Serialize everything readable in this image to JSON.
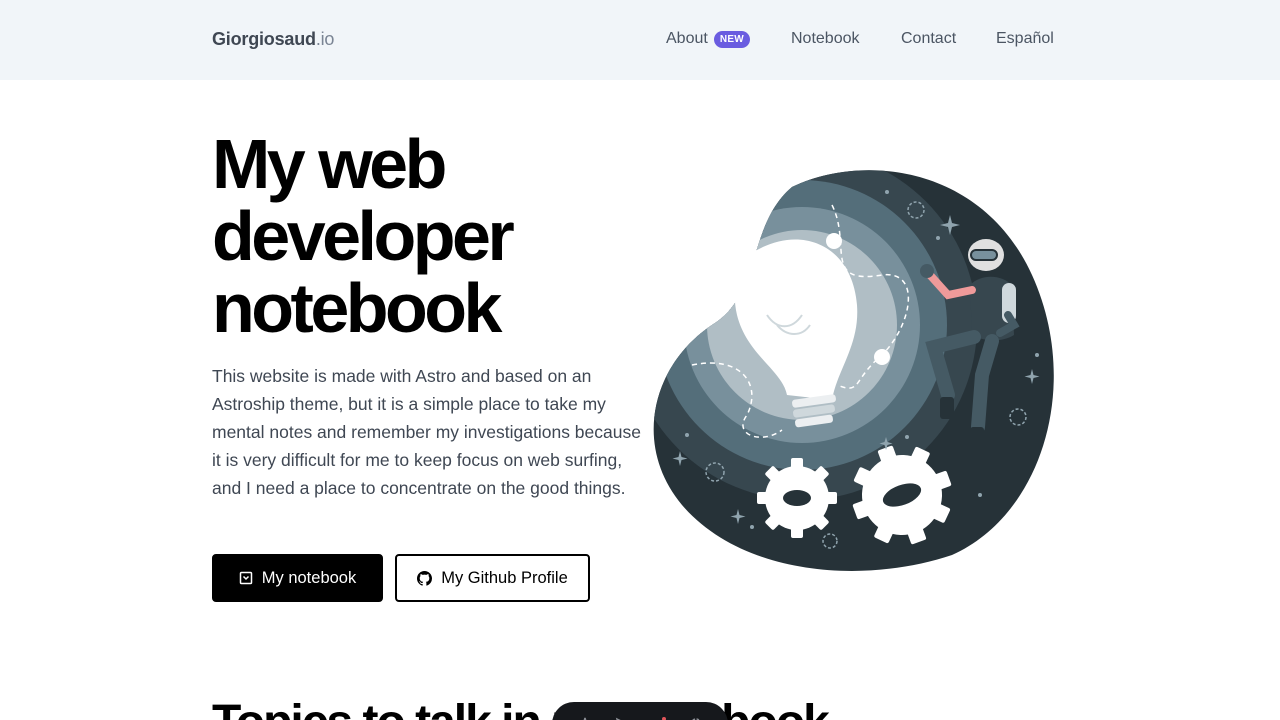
{
  "header": {
    "logo_main": "Giorgiosaud",
    "logo_tld": ".io",
    "nav": {
      "about": "About",
      "about_badge": "NEW",
      "notebook": "Notebook",
      "contact": "Contact",
      "language": "Español"
    }
  },
  "hero": {
    "title_lines": [
      "My web",
      "developer",
      "notebook"
    ],
    "description": "This website is made with Astro and based on an Astroship theme, but it is a simple place to take my mental notes and remember my investigations because it is very difficult for me to keep focus on web surfing, and I need a place to concentrate on the good things.",
    "primary_button": "My notebook",
    "secondary_button": "My Github Profile",
    "illustration_icon": "lightbulb-astronaut-illustration"
  },
  "section": {
    "topics_title": "Topics to talk in my notebook"
  },
  "colors": {
    "header_bg": "#f1f5f9",
    "badge": "#6a5ce0",
    "illustration_bg": "#263238"
  }
}
